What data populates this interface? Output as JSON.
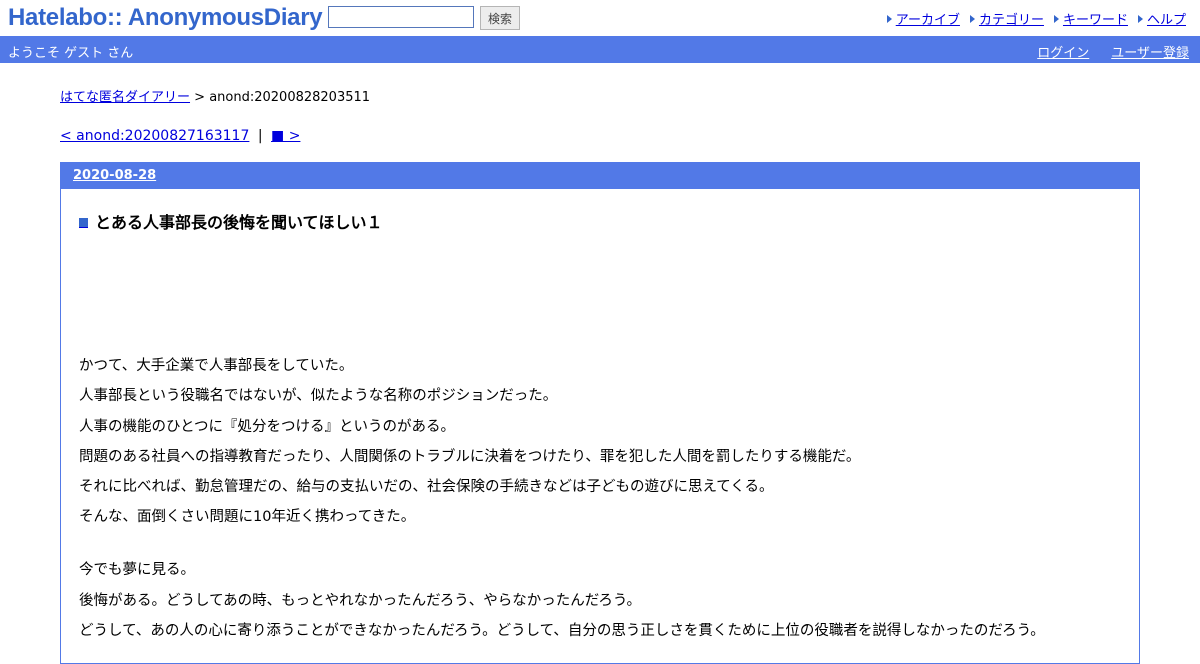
{
  "header": {
    "logo": "Hatelabo:: AnonymousDiary",
    "search_placeholder": "",
    "search_value": "",
    "search_button": "検索",
    "links": [
      "アーカイブ",
      "カテゴリー",
      "キーワード",
      "ヘルプ"
    ]
  },
  "welcome_bar": {
    "welcome": "ようこそ ゲスト さん",
    "login": "ログイン",
    "register": "ユーザー登録"
  },
  "breadcrumb": {
    "home": "はてな匿名ダイアリー",
    "separator": ">",
    "current": "anond:20200828203511"
  },
  "pager": {
    "prev": "< anond:20200827163117",
    "separator": "|",
    "next": "■ >"
  },
  "day": {
    "date": "2020-08-28",
    "title": "とある人事部長の後悔を聞いてほしい１",
    "paragraph1": [
      "かつて、大手企業で人事部長をしていた。",
      "人事部長という役職名ではないが、似たような名称のポジションだった。",
      "人事の機能のひとつに『処分をつける』というのがある。",
      "問題のある社員への指導教育だったり、人間関係のトラブルに決着をつけたり、罪を犯した人間を罰したりする機能だ。",
      "それに比べれば、勤怠管理だの、給与の支払いだの、社会保険の手続きなどは子どもの遊びに思えてくる。",
      "そんな、面倒くさい問題に10年近く携わってきた。"
    ],
    "paragraph2": [
      "今でも夢に見る。",
      "後悔がある。どうしてあの時、もっとやれなかったんだろう、やらなかったんだろう。",
      "どうして、あの人の心に寄り添うことができなかったんだろう。どうして、自分の思う正しさを貫くために上位の役職者を説得しなかったのだろう。"
    ]
  },
  "colors": {
    "accent": "#5279e7",
    "logo": "#3366cc",
    "link": "#0000dd"
  }
}
